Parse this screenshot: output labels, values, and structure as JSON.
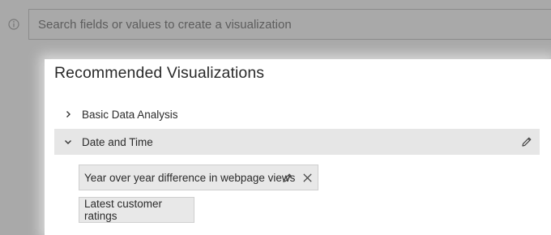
{
  "search": {
    "placeholder": "Search fields or values to create a visualization",
    "value": ""
  },
  "panel": {
    "title": "Recommended Visualizations",
    "groups": [
      {
        "label": "Basic Data Analysis",
        "expanded": false,
        "chevron_icon": "chevron-right-icon"
      },
      {
        "label": "Date and Time",
        "expanded": true,
        "chevron_icon": "chevron-down-icon",
        "action_icon": "pencil-icon",
        "items": [
          {
            "label": "Year over year difference in webpage views",
            "action_icons": [
              "pencil-icon",
              "close-icon"
            ]
          },
          {
            "label": "Latest customer ratings"
          }
        ]
      }
    ]
  },
  "icons": {
    "info": "info-icon"
  },
  "colors": {
    "overlay": "#a9a9a9",
    "panel_bg": "#ffffff",
    "selected_row": "#e6e6e6",
    "chip_bg": "#e8e8e8",
    "text": "#2b2b2b"
  }
}
